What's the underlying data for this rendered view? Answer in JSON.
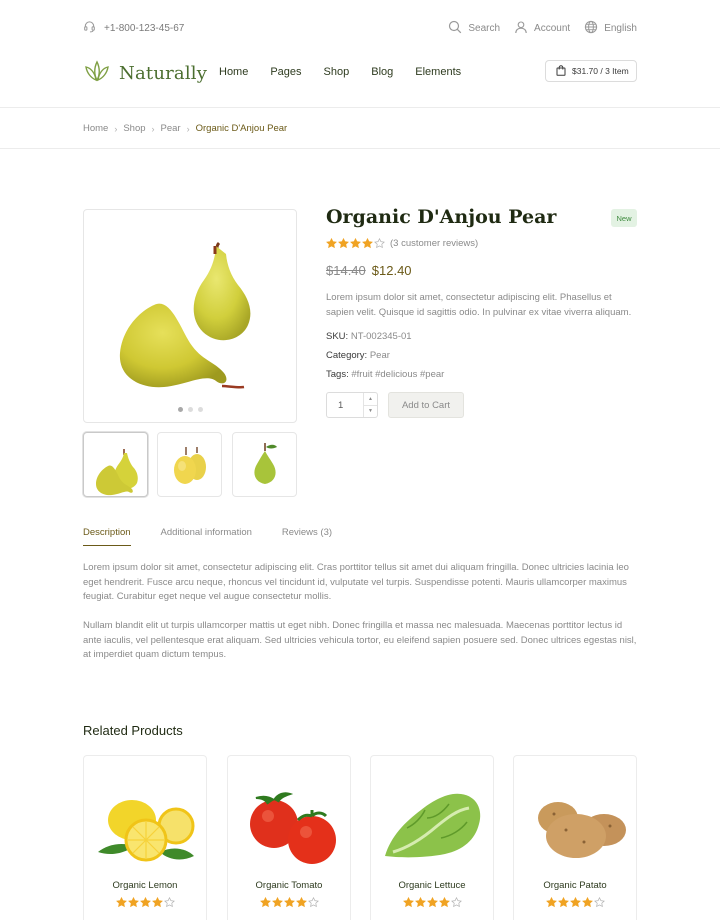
{
  "topbar": {
    "phone": "+1-800-123-45-67",
    "search_label": "Search",
    "account_label": "Account",
    "language_label": "English"
  },
  "header": {
    "logo_text": "Naturally",
    "nav": [
      "Home",
      "Pages",
      "Shop",
      "Blog",
      "Elements"
    ],
    "cart_label": "$31.70 / 3 Item"
  },
  "breadcrumb": [
    "Home",
    "Shop",
    "Pear",
    "Organic D'Anjou Pear"
  ],
  "product": {
    "title": "Organic D'Anjou Pear",
    "badge": "New",
    "rating": 4,
    "reviews_label": "(3 customer reviews)",
    "old_price": "$14.40",
    "price": "$12.40",
    "description": "Lorem ipsum dolor sit amet, consectetur adipiscing elit. Phasellus et sapien velit. Quisque id sagittis odio. In pulvinar ex vitae viverra aliquam.",
    "sku_label": "SKU:",
    "sku": "NT-002345-01",
    "category_label": "Category:",
    "category": "Pear",
    "tags_label": "Tags:",
    "tags": "#fruit #delicious #pear",
    "quantity": "1",
    "add_to_cart": "Add to Cart"
  },
  "tabs": [
    "Description",
    "Additional information",
    "Reviews (3)"
  ],
  "description": {
    "p1": "Lorem ipsum dolor sit amet, consectetur adipiscing elit. Cras porttitor tellus sit amet dui aliquam fringilla. Donec ultricies lacinia leo eget hendrerit. Fusce arcu neque, rhoncus vel tincidunt id, vulputate vel turpis. Suspendisse potenti. Mauris ullamcorper maximus feugiat. Curabitur eget neque vel augue consectetur mollis.",
    "p2": "Nullam blandit elit ut turpis ullamcorper mattis ut eget nibh. Donec fringilla et massa nec malesuada. Maecenas porttitor lectus id ante iaculis, vel pellentesque erat aliquam. Sed ultricies vehicula tortor, eu eleifend sapien posuere sed. Donec ultrices egestas nisl, at imperdiet quam dictum tempus."
  },
  "related": {
    "title": "Related Products",
    "items": [
      {
        "name": "Organic Lemon",
        "rating": 4
      },
      {
        "name": "Organic Tomato",
        "rating": 4
      },
      {
        "name": "Organic Lettuce",
        "rating": 4
      },
      {
        "name": "Organic Patato",
        "rating": 4
      }
    ]
  },
  "colors": {
    "brand": "#4b6e2f",
    "accent": "#6b5a18",
    "star": "#f0a323",
    "badge_bg": "#e3f2e3"
  }
}
